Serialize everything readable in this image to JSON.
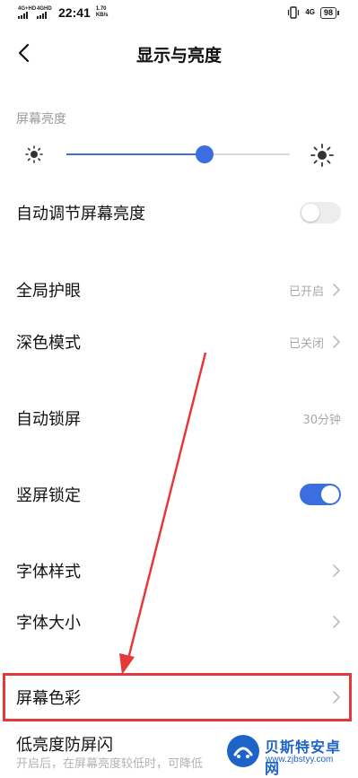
{
  "status_bar": {
    "sim1": "4G+HD",
    "sim2": "4GHD",
    "time": "22:41",
    "speed_value": "1.70",
    "speed_unit": "KB/s",
    "net": "4G",
    "battery": "98"
  },
  "header": {
    "title": "显示与亮度"
  },
  "brightness": {
    "section_label": "屏幕亮度",
    "level": 0.62
  },
  "rows": {
    "auto_brightness": {
      "label": "自动调节屏幕亮度",
      "enabled": false
    },
    "eye_protect": {
      "label": "全局护眼",
      "value": "已开启"
    },
    "dark_mode": {
      "label": "深色模式",
      "value": "已关闭"
    },
    "auto_lock": {
      "label": "自动锁屏",
      "value": "30分钟"
    },
    "portrait_lock": {
      "label": "竖屏锁定",
      "enabled": true
    },
    "font_style": {
      "label": "字体样式"
    },
    "font_size": {
      "label": "字体大小"
    },
    "screen_color": {
      "label": "屏幕色彩"
    },
    "low_flicker": {
      "label": "低亮度防屏闪",
      "sub": "开启后，在屏幕亮度较低时，可降低"
    }
  },
  "watermark": {
    "title": "贝斯特安卓网",
    "url": "www.zjbstyy.com"
  },
  "colors": {
    "accent": "#3b6fe0",
    "highlight": "#e5383b",
    "watermark": "#1e63c7"
  }
}
